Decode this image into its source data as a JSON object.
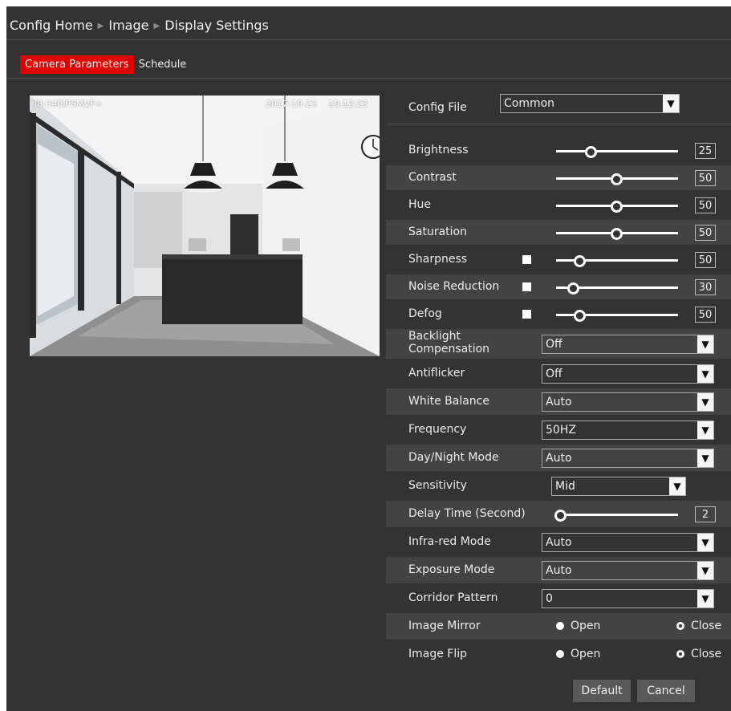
{
  "breadcrumb": {
    "home": "Config Home",
    "image": "Image",
    "current": "Display Settings"
  },
  "tabs": [
    {
      "label": "Camera Parameters"
    },
    {
      "label": "Schedule"
    }
  ],
  "preview": {
    "camera_name": "I8-340IP5MVF+",
    "date": "2017-10-23",
    "time": "10:12:23"
  },
  "config_file": {
    "label": "Config File",
    "value": "Common"
  },
  "sliders": {
    "brightness": {
      "label": "Brightness",
      "value": "25"
    },
    "contrast": {
      "label": "Contrast",
      "value": "50"
    },
    "hue": {
      "label": "Hue",
      "value": "50"
    },
    "saturation": {
      "label": "Saturation",
      "value": "50"
    },
    "sharpness": {
      "label": "Sharpness",
      "value": "50"
    },
    "noise_reduction": {
      "label": "Noise Reduction",
      "value": "30"
    },
    "defog": {
      "label": "Defog",
      "value": "50"
    },
    "delay_time": {
      "label": "Delay Time (Second)",
      "value": "2"
    }
  },
  "selects": {
    "backlight": {
      "label_line1": "Backlight",
      "label_line2": "Compensation",
      "value": "Off"
    },
    "antiflicker": {
      "label": "Antiflicker",
      "value": "Off"
    },
    "white_balance": {
      "label": "White Balance",
      "value": "Auto"
    },
    "frequency": {
      "label": "Frequency",
      "value": "50HZ"
    },
    "day_night": {
      "label": "Day/Night Mode",
      "value": "Auto"
    },
    "sensitivity": {
      "label": "Sensitivity",
      "value": "Mid"
    },
    "infrared": {
      "label": "Infra-red Mode",
      "value": "Auto"
    },
    "exposure": {
      "label": "Exposure Mode",
      "value": "Auto"
    },
    "corridor": {
      "label": "Corridor Pattern",
      "value": "0"
    }
  },
  "radios": {
    "image_mirror": {
      "label": "Image Mirror",
      "open": "Open",
      "close": "Close",
      "selected": "Close"
    },
    "image_flip": {
      "label": "Image Flip",
      "open": "Open",
      "close": "Close",
      "selected": "Close"
    }
  },
  "buttons": {
    "default": "Default",
    "cancel": "Cancel"
  },
  "colors": {
    "panel": "#333333",
    "row_alt": "#434343",
    "accent": "#e00000"
  }
}
